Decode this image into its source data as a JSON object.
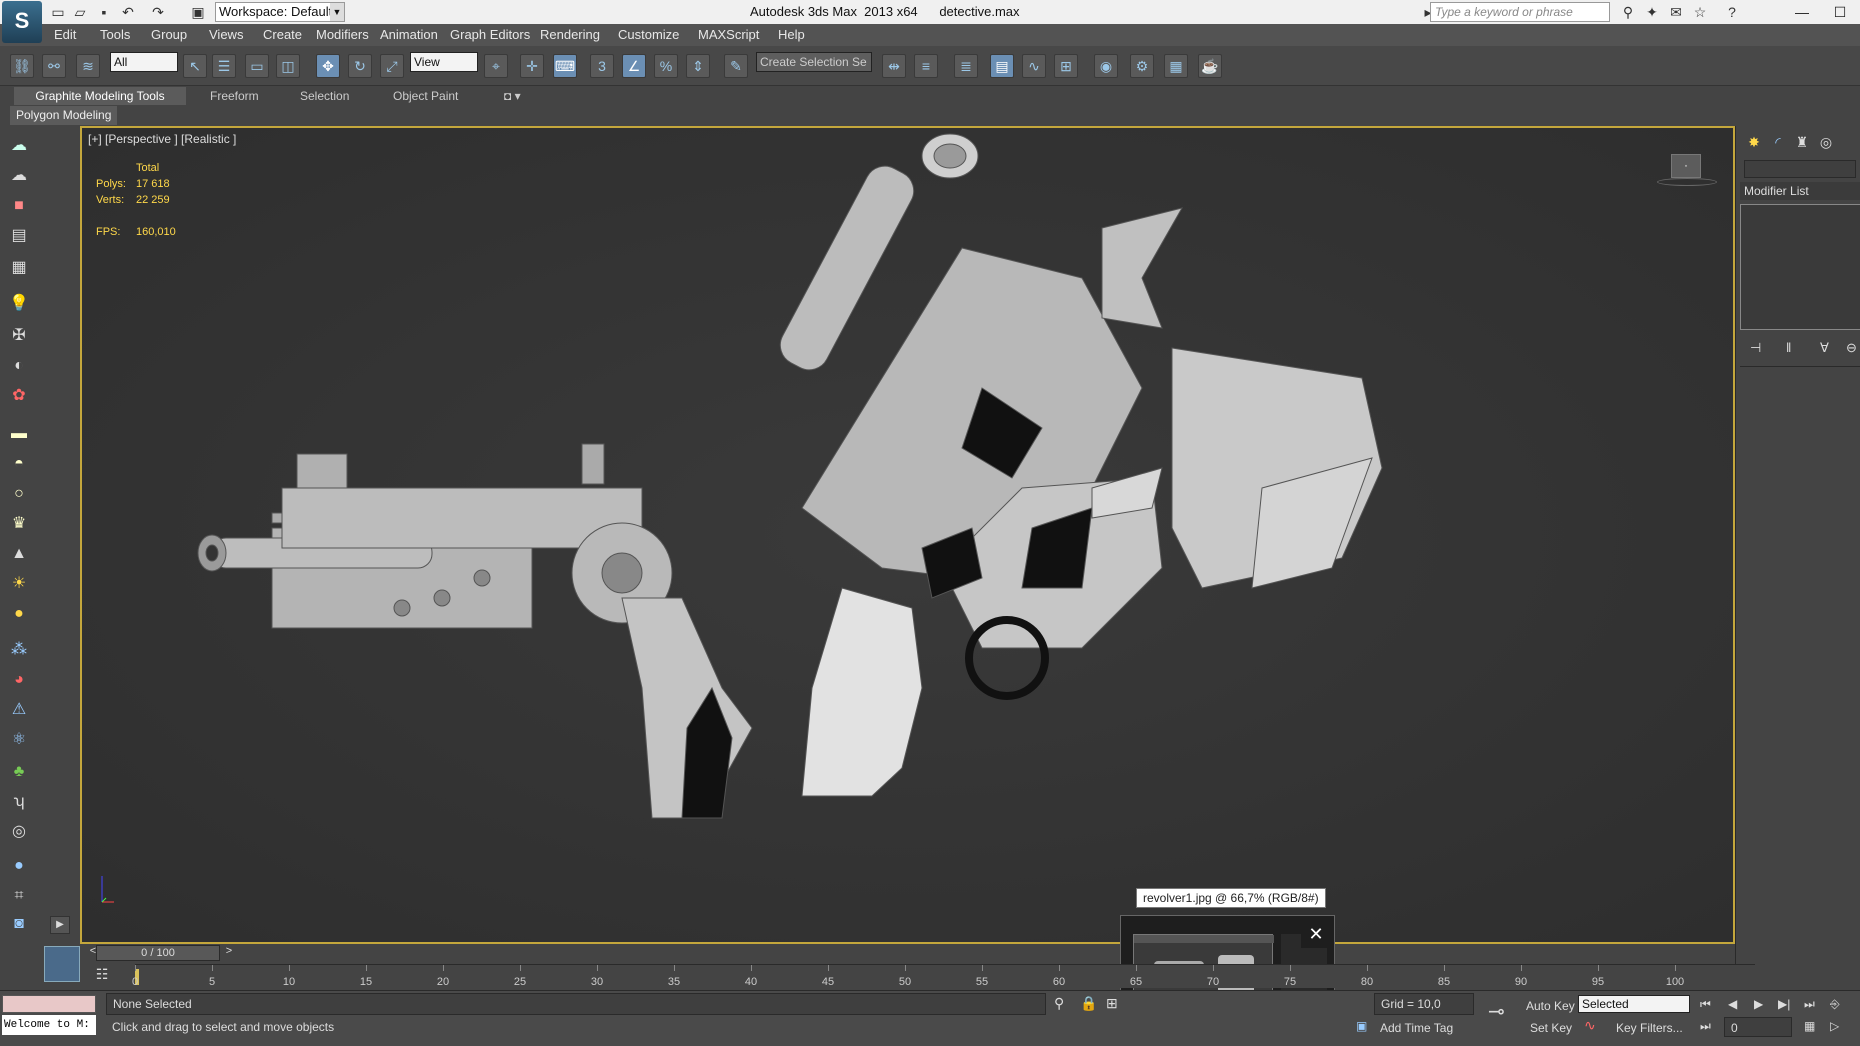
{
  "titlebar": {
    "app_title": "Autodesk 3ds Max  2013 x64      detective.max",
    "workspace": "Workspace: Default",
    "search_placeholder": "Type a keyword or phrase"
  },
  "menu": [
    "Edit",
    "Tools",
    "Group",
    "Views",
    "Create",
    "Modifiers",
    "Animation",
    "Graph Editors",
    "Rendering",
    "Customize",
    "MAXScript",
    "Help"
  ],
  "toolbar": {
    "selection_filter": "All",
    "ref_coord": "View",
    "named_sel": "Create Selection Se",
    "snap_label": "3"
  },
  "ribbon": {
    "tabs": [
      "Graphite Modeling Tools",
      "Freeform",
      "Selection",
      "Object Paint"
    ],
    "panel": "Polygon Modeling"
  },
  "viewport": {
    "label": "[+] [Perspective ] [Realistic ]",
    "total": "Total",
    "polys_label": "Polys:",
    "polys": "17 618",
    "verts_label": "Verts:",
    "verts": "22 259",
    "fps_label": "FPS:",
    "fps": "160,010"
  },
  "right_panel": {
    "modifier_list": "Modifier List"
  },
  "tooltip": "revolver1.jpg @ 66,7% (RGB/8#)",
  "timeline": {
    "slider": "0 / 100",
    "ticks": [
      "0",
      "5",
      "10",
      "15",
      "20",
      "25",
      "30",
      "35",
      "40",
      "45",
      "50",
      "55",
      "60",
      "65",
      "70",
      "75",
      "80",
      "85",
      "90",
      "95",
      "100"
    ]
  },
  "status": {
    "listener": "Welcome to M:",
    "selection": "None Selected",
    "prompt": "Click and drag to select and move objects",
    "grid": "Grid = 10,0",
    "add_time_tag": "Add Time Tag",
    "auto_key": "Auto Key",
    "set_key": "Set Key",
    "key_mode": "Selected",
    "key_filters": "Key Filters...",
    "frame": "0"
  }
}
